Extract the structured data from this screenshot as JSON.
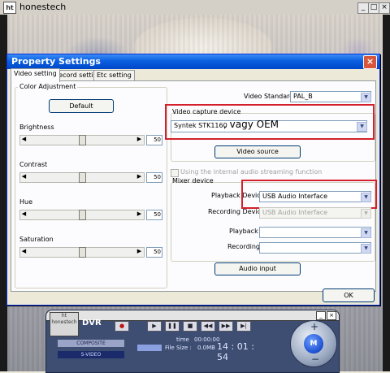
{
  "app": {
    "title": "honestech",
    "logo_text": "ht",
    "controls": [
      "_",
      "□",
      "×"
    ]
  },
  "dialog": {
    "title": "Property Settings",
    "close_label": "×",
    "tabs": [
      {
        "label": "Video setting"
      },
      {
        "label": "Record setting"
      },
      {
        "label": "Etc setting"
      }
    ],
    "color_adjustment": {
      "label": "Color Adjustment",
      "default_button": "Default",
      "sliders": [
        {
          "label": "Brightness",
          "value": "50",
          "level": 0.5
        },
        {
          "label": "Contrast",
          "value": "50",
          "level": 0.5
        },
        {
          "label": "Hue",
          "value": "50",
          "level": 0.5
        },
        {
          "label": "Saturation",
          "value": "50",
          "level": 0.5
        }
      ]
    },
    "video_standard": {
      "label": "Video Standard :",
      "value": "PAL_B"
    },
    "capture_device": {
      "label": "Video capture device",
      "value": "Syntek STK1160",
      "annotation": ", vagy OEM",
      "source_button": "Video source"
    },
    "internal_audio_checkbox": "Using the internal audio streaming function",
    "mixer": {
      "label": "Mixer device",
      "playback_device_label": "Playback Device :",
      "playback_device_value": "USB Audio Interface",
      "recording_device_label": "Recording Device :",
      "recording_device_value": "USB Audio Interface",
      "playback_label": "Playback :",
      "playback_value": "",
      "recording_label": "Recording :",
      "recording_value": "",
      "audio_input_button": "Audio input"
    },
    "ok_button": "OK"
  },
  "dvr": {
    "logo_text": "ht honestech",
    "title": "DVR",
    "source_composite": "COMPOSITE",
    "source_svideo": "S-VIDEO",
    "time_label": "time",
    "time_value": "00:00:00",
    "file_size_label": "File Size :",
    "file_size_value": "0.0MB",
    "clock": "14 : 01 : 54",
    "knob_label": "M",
    "knob_plus": "+",
    "knob_minus": "−",
    "window_controls": [
      "_",
      "×"
    ]
  },
  "colors": {
    "highlight_box": "#d3202a",
    "dialog_title": "#0a5fe0",
    "dvr_body": "#3e4e72"
  }
}
